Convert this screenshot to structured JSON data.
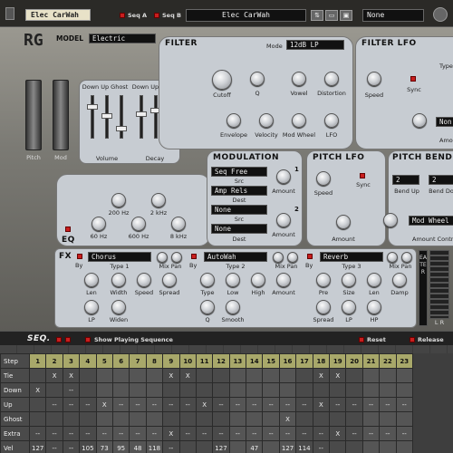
{
  "device": {
    "patch_name_tag": "Elec CarWah",
    "seq_a_label": "Seq A",
    "seq_b_label": "Seq B",
    "patch_display": "Elec CarWah",
    "right_display": "None",
    "logo": "RG",
    "model_label": "MODEL",
    "model_value": "Electric"
  },
  "wheels": {
    "pitch": "Pitch",
    "mod": "Mod"
  },
  "envelope": {
    "volume_header": "Down Up Ghost",
    "decay_header": "Down Up Ghost",
    "volume_label": "Volume",
    "decay_label": "Decay"
  },
  "eq": {
    "title": "EQ",
    "knobs": [
      "200 Hz",
      "2 kHz",
      "60 Hz",
      "600 Hz",
      "8 kHz"
    ]
  },
  "filter": {
    "title": "FILTER",
    "mode_label": "Mode",
    "mode_value": "12dB LP",
    "knobs_top": [
      "Cutoff",
      "Q",
      "Vowel",
      "Distortion"
    ],
    "knobs_bottom": [
      "Envelope",
      "Velocity",
      "Mod Wheel",
      "LFO"
    ]
  },
  "filter_lfo": {
    "title": "FILTER LFO",
    "type_label": "Type",
    "speed_label": "Speed",
    "sync_label": "Sync",
    "amount_label": "Amo",
    "non_value": "Non"
  },
  "modulation": {
    "title": "MODULATION",
    "src1": "Seq Free",
    "src_label": "Src",
    "dest1": "Amp Rels",
    "dest_label": "Dest",
    "src2": "None",
    "dest2": "None",
    "amount_label": "Amount",
    "num1": "1",
    "num2": "2"
  },
  "pitch_lfo": {
    "title": "PITCH LFO",
    "speed_label": "Speed",
    "sync_label": "Sync",
    "amount_label": "Amount"
  },
  "pitch_bend": {
    "title": "PITCH BEND",
    "bend_up_value": "2",
    "bend_down_value": "2",
    "bend_up_label": "Bend Up",
    "bend_down_label": "Bend Do",
    "mod_wheel_value": "Mod Wheel",
    "amount_control_label": "Amount Contro"
  },
  "fx": {
    "title": "FX",
    "by_label": "By",
    "mix_pan_label": "Mix Pan",
    "slot1": {
      "type": "Chorus",
      "type_label": "Type 1",
      "knobs_top": [
        "Len",
        "Width",
        "Speed",
        "Spread"
      ],
      "knobs_bottom": [
        "LP",
        "Widen"
      ]
    },
    "slot2": {
      "type": "AutoWah",
      "type_label": "Type 2",
      "knobs_top": [
        "Type",
        "Low",
        "High",
        "Amount"
      ],
      "knobs_bottom": [
        "Q",
        "Smooth"
      ]
    },
    "slot3": {
      "type": "Reverb",
      "type_label": "Type 3",
      "knobs_top": [
        "Pre",
        "Size",
        "Len",
        "Damp"
      ],
      "knobs_bottom": [
        "Spread",
        "LP",
        "HP"
      ]
    },
    "side": "EATER",
    "lr": "L R"
  },
  "sequencer": {
    "title": "SEQ.",
    "show_playing": "Show Playing Sequence",
    "reset": "Reset",
    "release": "Release",
    "rows": [
      {
        "label": "Step",
        "cells": [
          "1",
          "2",
          "3",
          "4",
          "5",
          "6",
          "7",
          "8",
          "9",
          "10",
          "11",
          "12",
          "13",
          "14",
          "15",
          "16",
          "17",
          "18",
          "19",
          "20",
          "21",
          "22",
          "23"
        ]
      },
      {
        "label": "Tie",
        "cells": [
          "",
          "X",
          "X",
          "",
          "",
          "",
          "",
          "",
          "X",
          "X",
          "",
          "",
          "",
          "",
          "",
          "",
          "",
          "X",
          "X",
          "",
          "",
          "",
          ""
        ]
      },
      {
        "label": "Down",
        "cells": [
          "X",
          "",
          "--",
          "",
          "",
          "",
          "",
          "",
          "",
          "",
          "",
          "",
          "",
          "",
          "",
          "",
          "",
          "",
          "",
          "",
          "",
          "",
          ""
        ]
      },
      {
        "label": "Up",
        "cells": [
          "",
          "--",
          "--",
          "--",
          "X",
          "--",
          "--",
          "--",
          "--",
          "--",
          "X",
          "--",
          "--",
          "--",
          "--",
          "--",
          "--",
          "X",
          "--",
          "--",
          "--",
          "--",
          "--"
        ]
      },
      {
        "label": "Ghost",
        "cells": [
          "",
          "",
          "",
          "",
          "",
          "",
          "",
          "",
          "",
          "",
          "",
          "",
          "",
          "",
          "",
          "X",
          "",
          "",
          "",
          "",
          "",
          "",
          ""
        ]
      },
      {
        "label": "Extra",
        "cells": [
          "--",
          "--",
          "--",
          "--",
          "--",
          "--",
          "--",
          "--",
          "X",
          "--",
          "--",
          "--",
          "--",
          "--",
          "--",
          "--",
          "--",
          "--",
          "X",
          "--",
          "--",
          "--",
          "--"
        ]
      },
      {
        "label": "Vel",
        "cells": [
          "127",
          "--",
          "--",
          "105",
          "73",
          "95",
          "48",
          "118",
          "--",
          "",
          "",
          "127",
          "",
          "47",
          "",
          "127",
          "114",
          "--",
          "",
          "",
          "",
          "",
          ""
        ]
      }
    ]
  }
}
